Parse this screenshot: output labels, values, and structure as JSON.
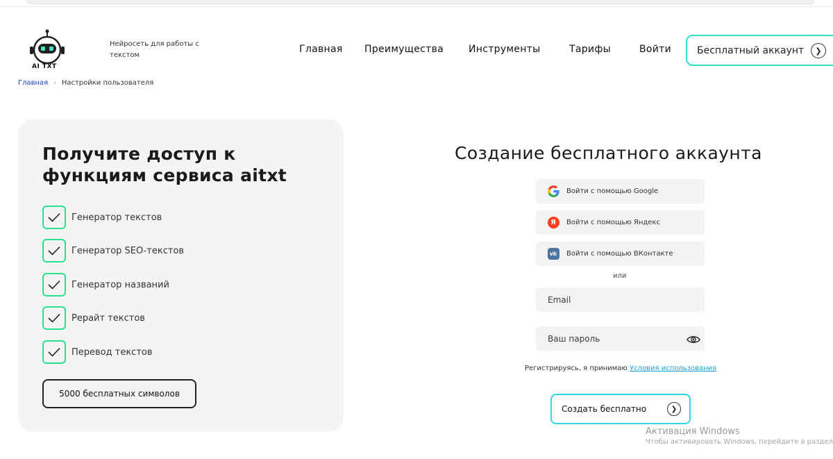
{
  "brand": {
    "logo_text": "AI TXT",
    "tagline": "Нейросеть для работы с текстом"
  },
  "nav": {
    "items": [
      "Главная",
      "Преимущества",
      "Инструменты",
      "Тарифы",
      "Войти"
    ],
    "cta_label": "Бесплатный аккаунт"
  },
  "breadcrumb": {
    "home": "Главная",
    "current": "Настройки пользователя"
  },
  "promo": {
    "title": "Получите доступ к функциям сервиса aitxt",
    "features": [
      "Генератор текстов",
      "Генератор SEO-текстов",
      "Генератор названий",
      "Рерайт текстов",
      "Перевод текстов"
    ],
    "badge": "5000 бесплатных символов"
  },
  "signup": {
    "title": "Создание бесплатного аккаунта",
    "google_label": "Войти с помощью Google",
    "yandex_label": "Войти с помощью Яндекс",
    "vk_label": "Войти с помощью ВКонтакте",
    "or_label": "или",
    "email_placeholder": "Email",
    "password_placeholder": "Ваш пароль",
    "terms_prefix": "Регистрируясь, я принимаю",
    "terms_link": "Условия использования",
    "submit_label": "Создать бесплатно"
  },
  "watermark": {
    "title": "Активация Windows",
    "subtitle": "Чтобы активировать Windows, перейдите в раздел \"Пар"
  },
  "colors": {
    "accent_green": "#25e38c",
    "accent_cyan": "#2fe0c4",
    "link_blue": "#1a3fd0"
  }
}
